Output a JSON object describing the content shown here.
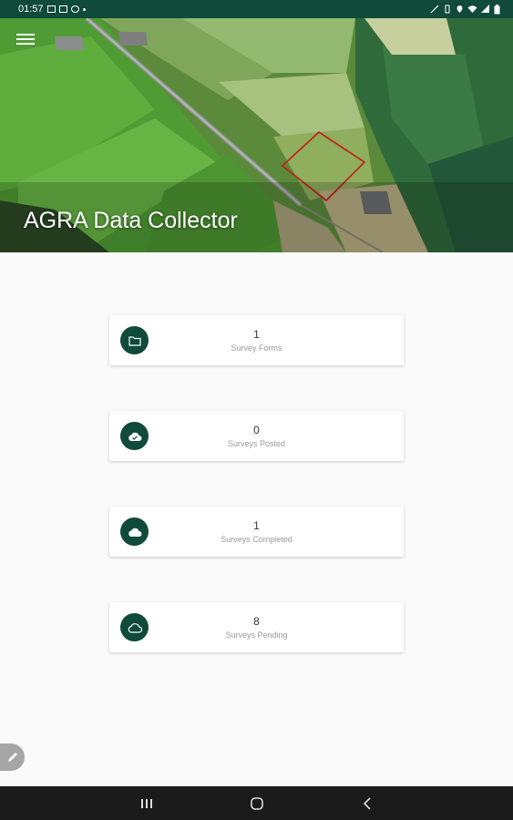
{
  "status_bar": {
    "time": "01:57",
    "left_icons": [
      "image-icon",
      "calendar-icon",
      "chat-icon",
      "dot-icon"
    ],
    "right_icons": [
      "mute-icon",
      "vibrate-icon",
      "location-icon",
      "wifi-icon",
      "signal-icon",
      "battery-icon"
    ]
  },
  "header": {
    "title": "AGRA Data Collector",
    "menu_icon": "menu-icon",
    "background": "aerial-farmland-image"
  },
  "stats": [
    {
      "count": "1",
      "label": "Survey Forms",
      "icon": "folder-icon"
    },
    {
      "count": "0",
      "label": "Surveys Posted",
      "icon": "cloud-done-icon"
    },
    {
      "count": "1",
      "label": "Surveys Completed",
      "icon": "cloud-filled-icon"
    },
    {
      "count": "8",
      "label": "Surveys Pending",
      "icon": "cloud-outline-icon"
    }
  ],
  "fab": {
    "icon": "pencil-icon"
  },
  "nav_bar": {
    "icons": [
      "recents-icon",
      "home-icon",
      "back-icon"
    ]
  },
  "colors": {
    "primary": "#0f4a3a",
    "card_bg": "#ffffff",
    "page_bg": "#fafafa"
  }
}
